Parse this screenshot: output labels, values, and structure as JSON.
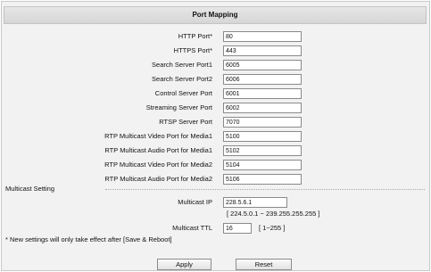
{
  "header": {
    "title": "Port Mapping"
  },
  "ports": [
    {
      "label": "HTTP Port*",
      "value": "80"
    },
    {
      "label": "HTTPS Port*",
      "value": "443"
    },
    {
      "label": "Search Server Port1",
      "value": "6005"
    },
    {
      "label": "Search Server Port2",
      "value": "6006"
    },
    {
      "label": "Control Server Port",
      "value": "6001"
    },
    {
      "label": "Streaming Server Port",
      "value": "6002"
    },
    {
      "label": "RTSP Server Port",
      "value": "7070"
    },
    {
      "label": "RTP Multicast Video Port for Media1",
      "value": "5100"
    },
    {
      "label": "RTP Multicast Audio Port for Media1",
      "value": "5102"
    },
    {
      "label": "RTP Multicast Video Port for Media2",
      "value": "5104"
    },
    {
      "label": "RTP Multicast Audio Port for Media2",
      "value": "5106"
    }
  ],
  "multicast": {
    "section_label": "Multicast Setting",
    "ip_label": "Multicast IP",
    "ip_value": "228.5.6.1",
    "ip_range": "[ 224.5.0.1 ~ 239.255.255.255 ]",
    "ttl_label": "Multicast TTL",
    "ttl_value": "16",
    "ttl_range": "[ 1~255 ]"
  },
  "note": "* New settings will only take effect after [Save & Reboot]",
  "buttons": {
    "apply": "Apply",
    "reset": "Reset"
  }
}
